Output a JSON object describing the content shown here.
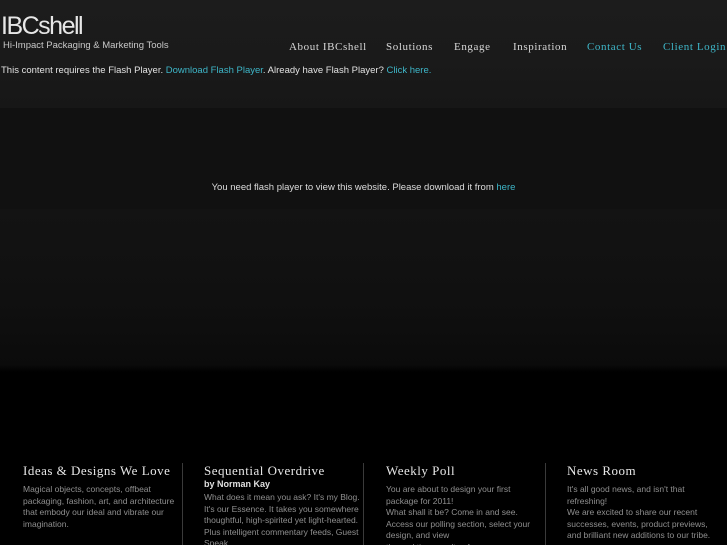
{
  "header": {
    "logo": "IBCshell",
    "tagline": "Hi-Impact Packaging & Marketing Tools"
  },
  "nav": {
    "items": [
      {
        "label": "About IBCshell"
      },
      {
        "label": "Solutions"
      },
      {
        "label": "Engage"
      },
      {
        "label": "Inspiration"
      },
      {
        "label": "Contact Us"
      },
      {
        "label": "Client Login"
      }
    ]
  },
  "flash_notice": {
    "text_before": "This content requires the Flash Player.",
    "download_link": "Download Flash Player",
    "text_middle": ". Already have Flash Player?",
    "click_link": "Click here."
  },
  "center_message": {
    "text": "You need flash player to view this website. Please download it from",
    "link": "here"
  },
  "columns": [
    {
      "title": "Ideas & Designs We Love",
      "byline": "",
      "body": "Magical objects, concepts, offbeat packaging, fashion, art, and architecture that embody our ideal and vibrate our imagination."
    },
    {
      "title": "Sequential Overdrive",
      "byline": "by Norman Kay",
      "body": "What does it mean you ask? It's my Blog. It's our Essence. It takes you somewhere thoughtful, high-spirited yet light-hearted. Plus intelligent commentary feeds, Guest Speak..."
    },
    {
      "title": "Weekly Poll",
      "byline": "",
      "body": "You are about to design your first package for 2011!\nWhat shall it be? Come in and see.\nAccess our polling section, select your design, and view\nthe real time results of our survey..."
    },
    {
      "title": "News Room",
      "byline": "",
      "body": "It's all good news, and isn't that refreshing!\nWe are excited to share our recent successes, events, product previews, and brilliant new additions to our tribe."
    }
  ],
  "colors": {
    "accent": "#3eb6c8",
    "nav_text": "#d7d7d7",
    "body_text": "#8f8f8f"
  }
}
